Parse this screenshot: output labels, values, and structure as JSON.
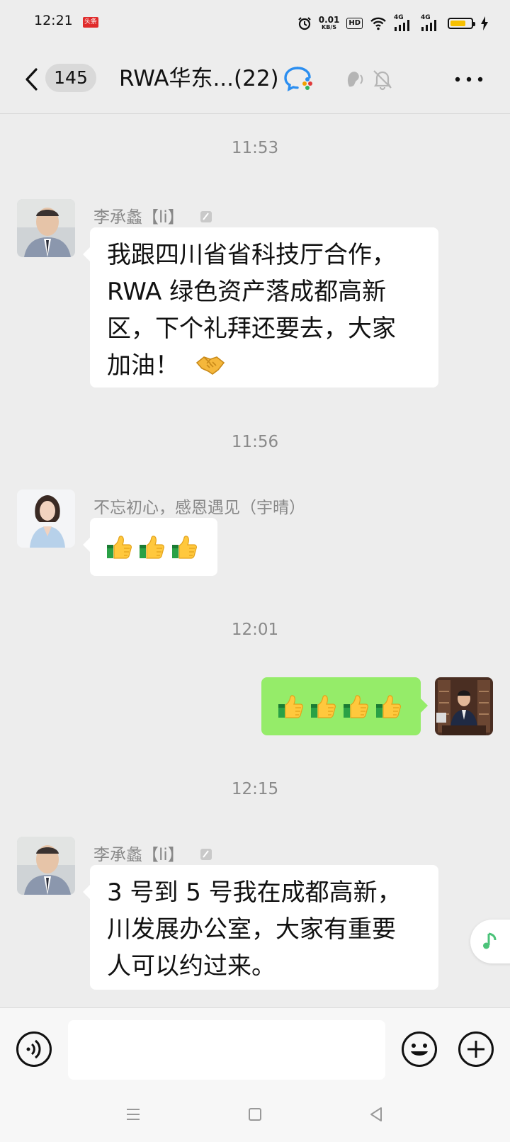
{
  "status_bar": {
    "time": "12:21",
    "notif_badge": "头条",
    "net_speed_value": "0.01",
    "net_speed_unit": "KB/S",
    "hd_label": "HD",
    "sim1": "4G",
    "sim2": "4G",
    "battery_level": 0.75,
    "icons": [
      "alarm-icon",
      "wifi-icon",
      "signal-icon",
      "battery-icon",
      "charging-icon"
    ]
  },
  "header": {
    "unread_count": "145",
    "title": "RWA华东...(22)",
    "icons": [
      "back-icon",
      "wecom-icon",
      "earpiece-icon",
      "mute-bell-icon",
      "more-icon"
    ]
  },
  "messages": [
    {
      "kind": "time",
      "text": "11:53"
    },
    {
      "kind": "msg",
      "side": "left",
      "sender": "李承蠡【li】",
      "text": "我跟四川省省科技厅合作，\nRWA 绿色资产落成都高新\n区，下个礼拜还要去，大家\n加油！",
      "emoji": "handshake"
    },
    {
      "kind": "time",
      "text": "11:56"
    },
    {
      "kind": "msg",
      "side": "left",
      "sender": "不忘初心，感恩遇见（宇晴）",
      "emoji_count": 3,
      "emoji": "thumbs-up"
    },
    {
      "kind": "time",
      "text": "12:01"
    },
    {
      "kind": "msg",
      "side": "right",
      "emoji_count": 4,
      "emoji": "thumbs-up"
    },
    {
      "kind": "time",
      "text": "12:15"
    },
    {
      "kind": "msg",
      "side": "left",
      "sender": "李承蠡【li】",
      "text": "3 号到 5 号我在成都高新，\n川发展办公室，大家有重要\n人可以约过来。"
    }
  ],
  "input": {
    "value": "",
    "placeholder": ""
  },
  "colors": {
    "background": "#ededed",
    "outgoing_bubble": "#95ec69",
    "incoming_bubble": "#ffffff",
    "timestamp_text": "#8a8a8a"
  }
}
